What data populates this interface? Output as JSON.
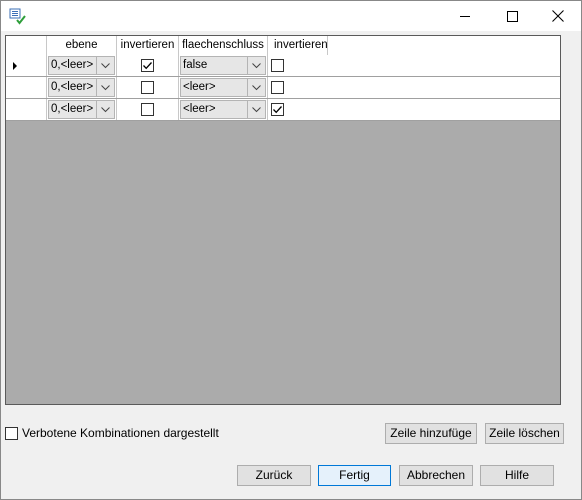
{
  "window": {
    "title": "",
    "icon": "data-grid-check-icon",
    "controls": {
      "minimize_icon": "minimize-icon",
      "maximize_icon": "maximize-icon",
      "close_icon": "close-icon"
    }
  },
  "grid": {
    "columns": [
      {
        "key": "rowheader",
        "label": ""
      },
      {
        "key": "ebene",
        "label": "ebene"
      },
      {
        "key": "invertieren1",
        "label": "invertieren"
      },
      {
        "key": "flaechenschluss",
        "label": "flaechenschluss"
      },
      {
        "key": "invertieren2",
        "label": "invertieren"
      }
    ],
    "rows": [
      {
        "current": true,
        "ebene": "0,<leer>",
        "invertieren1": true,
        "flaechenschluss": "false",
        "invertieren2": false
      },
      {
        "current": false,
        "ebene": "0,<leer>",
        "invertieren1": false,
        "flaechenschluss": "<leer>",
        "invertieren2": false
      },
      {
        "current": false,
        "ebene": "0,<leer>",
        "invertieren1": false,
        "flaechenschluss": "<leer>",
        "invertieren2": true
      }
    ]
  },
  "options": {
    "verbotene_label": "Verbotene Kombinationen dargestellt",
    "verbotene_checked": false
  },
  "buttons": {
    "add_row": "Zeile hinzufüge",
    "delete_row": "Zeile löschen",
    "back": "Zurück",
    "finish": "Fertig",
    "cancel": "Abbrechen",
    "help": "Hilfe"
  },
  "colors": {
    "grid_background": "#ababab",
    "default_button_border": "#0078d7"
  }
}
